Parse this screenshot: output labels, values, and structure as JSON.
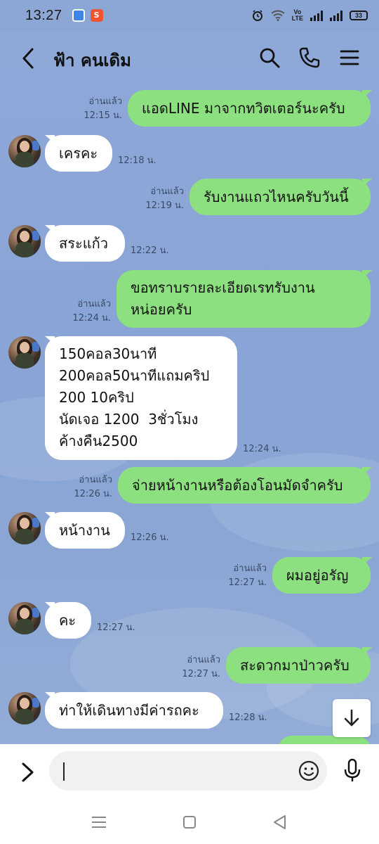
{
  "status_bar": {
    "time": "13:27",
    "notif_icon_2": "S",
    "volte": "Vo\nLTE",
    "battery": "33"
  },
  "header": {
    "contact_name": "ฟ้า คนเดิม",
    "back_icon": "chevron-left-icon",
    "search_icon": "search-icon",
    "call_icon": "phone-icon",
    "menu_icon": "menu-icon"
  },
  "messages": [
    {
      "dir": "out",
      "text": "แอดLINE มาจากทวิตเตอร์นะครับ",
      "read": "อ่านแล้ว",
      "time": "12:15 น."
    },
    {
      "dir": "in",
      "text": "เครคะ",
      "time": "12:18 น."
    },
    {
      "dir": "out",
      "text": "รับงานแถวไหนครับวันนี้",
      "read": "อ่านแล้ว",
      "time": "12:19 น."
    },
    {
      "dir": "in",
      "text": "สระแก้ว",
      "time": "12:22 น."
    },
    {
      "dir": "out",
      "text": "ขอทราบรายละเอียดเรทรับงาน\nหน่อยครับ",
      "read": "อ่านแล้ว",
      "time": "12:24 น."
    },
    {
      "dir": "in",
      "text": "150คอล30นาที\n200คอล50นาทีแถมคริป\n200 10คริป\nนัดเจอ 1200  3ชั่วโมง\nค้างคืน2500",
      "time": "12:24 น."
    },
    {
      "dir": "out",
      "text": "จ่ายหน้างานหรือต้องโอนมัดจำครับ",
      "read": "อ่านแล้ว",
      "time": "12:26 น."
    },
    {
      "dir": "in",
      "text": "หน้างาน",
      "time": "12:26 น."
    },
    {
      "dir": "out",
      "text": "ผมอยู่อรัญ",
      "read": "อ่านแล้ว",
      "time": "12:27 น."
    },
    {
      "dir": "in",
      "text": "คะ",
      "time": "12:27 น."
    },
    {
      "dir": "out",
      "text": "สะดวกมาป่าวครับ",
      "read": "อ่านแล้ว",
      "time": "12:27 น."
    },
    {
      "dir": "in",
      "text": "ท่าให้เดินทางมีค่ารถคะ",
      "time": "12:28 น."
    }
  ],
  "input": {
    "value": "",
    "placeholder": ""
  },
  "colors": {
    "chat_bg": "#8ea8d8",
    "outgoing_bubble": "#8de07f",
    "incoming_bubble": "#ffffff"
  }
}
